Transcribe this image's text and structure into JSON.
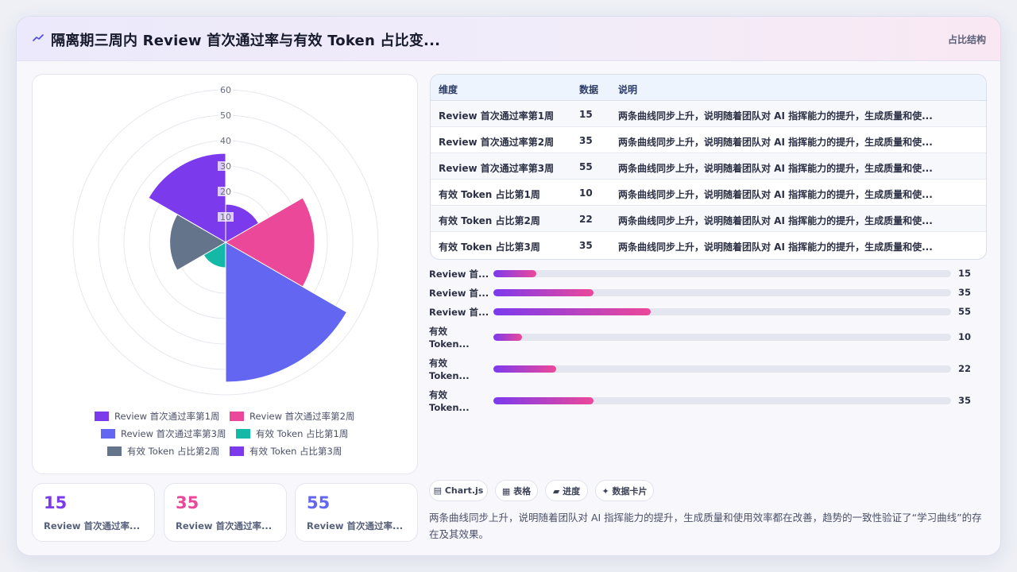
{
  "header": {
    "title": "隔离期三周内 Review 首次通过率与有效 Token 占比变...",
    "tag": "占比结构"
  },
  "colors": {
    "purple": "#7c3aed",
    "pink": "#ec4899",
    "indigo": "#6366f1",
    "teal": "#14b8a6",
    "slate": "#64748b",
    "violet": "#7c3aed"
  },
  "chart_data": {
    "type": "polarArea",
    "categories": [
      "Review 首次通过率第1周",
      "Review 首次通过率第2周",
      "Review 首次通过率第3周",
      "有效 Token 占比第1周",
      "有效 Token 占比第2周",
      "有效 Token 占比第3周"
    ],
    "values": [
      15,
      35,
      55,
      10,
      22,
      35
    ],
    "colors": [
      "#7c3aed",
      "#ec4899",
      "#6366f1",
      "#14b8a6",
      "#64748b",
      "#7c3aed"
    ],
    "r_ticks": [
      "10",
      "20",
      "30",
      "40",
      "50",
      "60"
    ],
    "rlim": [
      0,
      60
    ],
    "legend": "bottom"
  },
  "legend": [
    {
      "label": "Review 首次通过率第1周",
      "color": "#7c3aed"
    },
    {
      "label": "Review 首次通过率第2周",
      "color": "#ec4899"
    },
    {
      "label": "Review 首次通过率第3周",
      "color": "#6366f1"
    },
    {
      "label": "有效 Token 占比第1周",
      "color": "#14b8a6"
    },
    {
      "label": "有效 Token 占比第2周",
      "color": "#64748b"
    },
    {
      "label": "有效 Token 占比第3周",
      "color": "#7c3aed"
    }
  ],
  "stats": [
    {
      "num": "15",
      "label": "Review 首次通过率...",
      "color": "#7c3aed"
    },
    {
      "num": "35",
      "label": "Review 首次通过率...",
      "color": "#ec4899"
    },
    {
      "num": "55",
      "label": "Review 首次通过率...",
      "color": "#6366f1"
    }
  ],
  "table": {
    "headers": [
      "维度",
      "数据",
      "说明"
    ],
    "rows": [
      [
        "Review 首次通过率第1周",
        "15",
        "两条曲线同步上升，说明随着团队对 AI 指挥能力的提升，生成质量和使..."
      ],
      [
        "Review 首次通过率第2周",
        "35",
        "两条曲线同步上升，说明随着团队对 AI 指挥能力的提升，生成质量和使..."
      ],
      [
        "Review 首次通过率第3周",
        "55",
        "两条曲线同步上升，说明随着团队对 AI 指挥能力的提升，生成质量和使..."
      ],
      [
        "有效 Token 占比第1周",
        "10",
        "两条曲线同步上升，说明随着团队对 AI 指挥能力的提升，生成质量和使..."
      ],
      [
        "有效 Token 占比第2周",
        "22",
        "两条曲线同步上升，说明随着团队对 AI 指挥能力的提升，生成质量和使..."
      ],
      [
        "有效 Token 占比第3周",
        "35",
        "两条曲线同步上升，说明随着团队对 AI 指挥能力的提升，生成质量和使..."
      ]
    ]
  },
  "progress": [
    {
      "label": "Review 首...",
      "value": 15,
      "max": 160
    },
    {
      "label": "Review 首...",
      "value": 35,
      "max": 160
    },
    {
      "label": "Review 首...",
      "value": 55,
      "max": 160
    },
    {
      "label": "有效 Token...",
      "value": 10,
      "max": 160
    },
    {
      "label": "有效 Token...",
      "value": 22,
      "max": 160
    },
    {
      "label": "有效 Token...",
      "value": 35,
      "max": 160
    }
  ],
  "chips": [
    "▤ Chart.js",
    "▦ 表格",
    "▰ 进度",
    "✦ 数据卡片"
  ],
  "note": "两条曲线同步上升，说明随着团队对 AI 指挥能力的提升，生成质量和使用效率都在改善，趋势的一致性验证了“学习曲线”的存在及其效果。"
}
